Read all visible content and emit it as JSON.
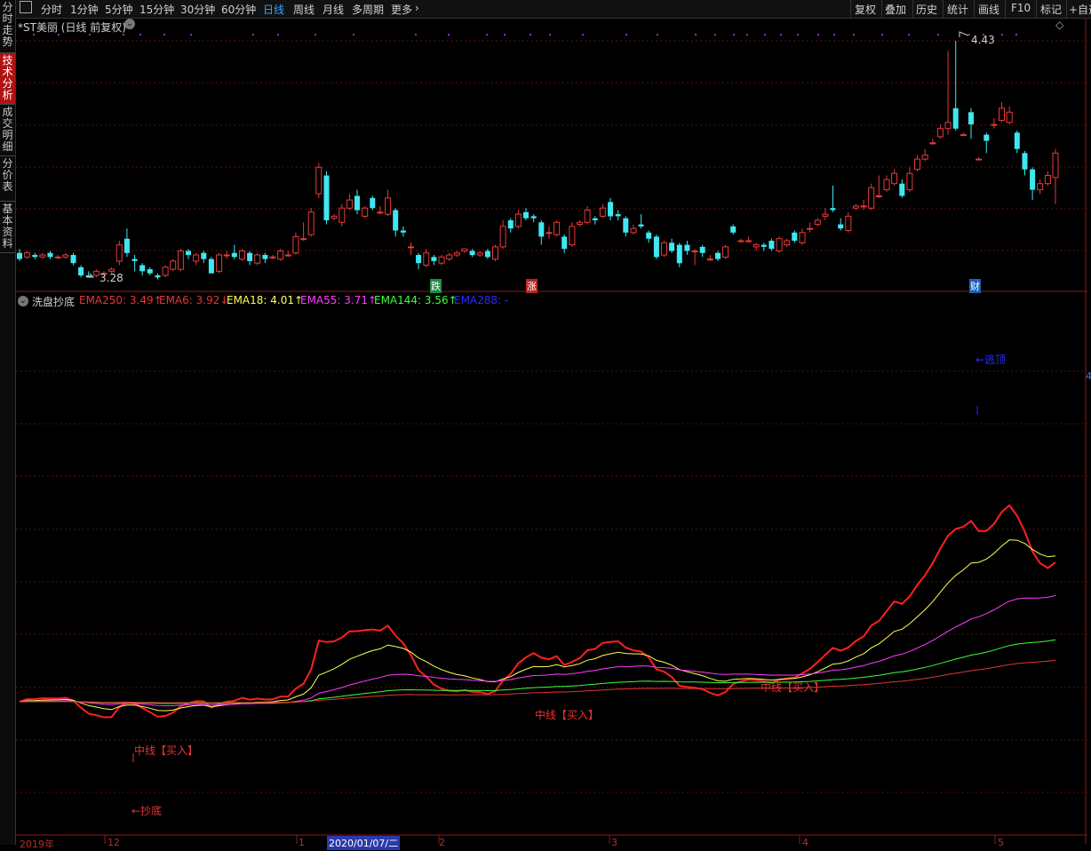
{
  "toolbar": {
    "items": [
      "分时",
      "1分钟",
      "5分钟",
      "15分钟",
      "30分钟",
      "60分钟",
      "日线",
      "周线",
      "月线",
      "多周期",
      "更多"
    ],
    "active": "日线",
    "right_items": [
      "复权",
      "叠加",
      "历史",
      "统计",
      "画线",
      "F10",
      "标记",
      "+自选"
    ]
  },
  "sidebar": {
    "tabs": [
      "分时走势",
      "技术分析",
      "成交明细",
      "分价表",
      "基本资料"
    ],
    "active": "技术分析"
  },
  "main_chart": {
    "title": "*ST美丽 (日线 前复权)",
    "high_label": "4.43",
    "low_label": "3.28",
    "markers": [
      {
        "text": "跌",
        "color": "#2fd06f"
      },
      {
        "text": "涨",
        "color": "#e23a3a"
      },
      {
        "text": "财",
        "color": "#3aa0ff"
      }
    ],
    "candles": [
      {
        "o": 3.39,
        "c": 3.36,
        "h": 3.41,
        "l": 3.35
      },
      {
        "o": 3.37,
        "c": 3.39,
        "h": 3.4,
        "l": 3.36
      },
      {
        "o": 3.38,
        "c": 3.37,
        "h": 3.39,
        "l": 3.36
      },
      {
        "o": 3.37,
        "c": 3.38,
        "h": 3.39,
        "l": 3.36
      },
      {
        "o": 3.39,
        "c": 3.37,
        "h": 3.4,
        "l": 3.36
      },
      {
        "o": 3.37,
        "c": 3.37,
        "h": 3.38,
        "l": 3.36
      },
      {
        "o": 3.37,
        "c": 3.38,
        "h": 3.39,
        "l": 3.36
      },
      {
        "o": 3.38,
        "c": 3.34,
        "h": 3.39,
        "l": 3.33
      },
      {
        "o": 3.32,
        "c": 3.28,
        "h": 3.33,
        "l": 3.27
      },
      {
        "o": 3.28,
        "c": 3.27,
        "h": 3.3,
        "l": 3.27
      },
      {
        "o": 3.28,
        "c": 3.3,
        "h": 3.31,
        "l": 3.27
      },
      {
        "o": 3.29,
        "c": 3.29,
        "h": 3.3,
        "l": 3.28
      },
      {
        "o": 3.3,
        "c": 3.31,
        "h": 3.32,
        "l": 3.29
      },
      {
        "o": 3.35,
        "c": 3.43,
        "h": 3.45,
        "l": 3.33
      },
      {
        "o": 3.46,
        "c": 3.39,
        "h": 3.51,
        "l": 3.37
      },
      {
        "o": 3.36,
        "c": 3.35,
        "h": 3.38,
        "l": 3.3
      },
      {
        "o": 3.33,
        "c": 3.3,
        "h": 3.34,
        "l": 3.28
      },
      {
        "o": 3.31,
        "c": 3.29,
        "h": 3.32,
        "l": 3.28
      },
      {
        "o": 3.28,
        "c": 3.27,
        "h": 3.29,
        "l": 3.26
      },
      {
        "o": 3.28,
        "c": 3.32,
        "h": 3.33,
        "l": 3.27
      },
      {
        "o": 3.31,
        "c": 3.35,
        "h": 3.36,
        "l": 3.3
      },
      {
        "o": 3.31,
        "c": 3.4,
        "h": 3.41,
        "l": 3.3
      },
      {
        "o": 3.4,
        "c": 3.38,
        "h": 3.41,
        "l": 3.36
      },
      {
        "o": 3.35,
        "c": 3.38,
        "h": 3.39,
        "l": 3.33
      },
      {
        "o": 3.39,
        "c": 3.36,
        "h": 3.4,
        "l": 3.34
      },
      {
        "o": 3.36,
        "c": 3.29,
        "h": 3.37,
        "l": 3.29
      },
      {
        "o": 3.3,
        "c": 3.38,
        "h": 3.39,
        "l": 3.29
      },
      {
        "o": 3.38,
        "c": 3.38,
        "h": 3.4,
        "l": 3.36
      },
      {
        "o": 3.39,
        "c": 3.37,
        "h": 3.43,
        "l": 3.36
      },
      {
        "o": 3.36,
        "c": 3.4,
        "h": 3.41,
        "l": 3.35
      },
      {
        "o": 3.39,
        "c": 3.35,
        "h": 3.4,
        "l": 3.33
      },
      {
        "o": 3.34,
        "c": 3.38,
        "h": 3.39,
        "l": 3.33
      },
      {
        "o": 3.38,
        "c": 3.36,
        "h": 3.39,
        "l": 3.34
      },
      {
        "o": 3.37,
        "c": 3.37,
        "h": 3.38,
        "l": 3.36
      },
      {
        "o": 3.36,
        "c": 3.4,
        "h": 3.41,
        "l": 3.35
      },
      {
        "o": 3.38,
        "c": 3.38,
        "h": 3.4,
        "l": 3.37
      },
      {
        "o": 3.39,
        "c": 3.47,
        "h": 3.49,
        "l": 3.38
      },
      {
        "o": 3.46,
        "c": 3.46,
        "h": 3.54,
        "l": 3.45
      },
      {
        "o": 3.48,
        "c": 3.59,
        "h": 3.61,
        "l": 3.47
      },
      {
        "o": 3.68,
        "c": 3.81,
        "h": 3.83,
        "l": 3.66
      },
      {
        "o": 3.77,
        "c": 3.55,
        "h": 3.79,
        "l": 3.53
      },
      {
        "o": 3.56,
        "c": 3.57,
        "h": 3.58,
        "l": 3.55
      },
      {
        "o": 3.54,
        "c": 3.61,
        "h": 3.63,
        "l": 3.52
      },
      {
        "o": 3.61,
        "c": 3.65,
        "h": 3.68,
        "l": 3.6
      },
      {
        "o": 3.67,
        "c": 3.6,
        "h": 3.7,
        "l": 3.58
      },
      {
        "o": 3.57,
        "c": 3.61,
        "h": 3.62,
        "l": 3.56
      },
      {
        "o": 3.66,
        "c": 3.61,
        "h": 3.67,
        "l": 3.6
      },
      {
        "o": 3.59,
        "c": 3.59,
        "h": 3.62,
        "l": 3.58
      },
      {
        "o": 3.58,
        "c": 3.66,
        "h": 3.7,
        "l": 3.57
      },
      {
        "o": 3.6,
        "c": 3.5,
        "h": 3.61,
        "l": 3.47
      },
      {
        "o": 3.5,
        "c": 3.49,
        "h": 3.52,
        "l": 3.47
      },
      {
        "o": 3.42,
        "c": 3.42,
        "h": 3.44,
        "l": 3.38
      },
      {
        "o": 3.38,
        "c": 3.34,
        "h": 3.39,
        "l": 3.31
      },
      {
        "o": 3.33,
        "c": 3.39,
        "h": 3.41,
        "l": 3.32
      },
      {
        "o": 3.37,
        "c": 3.35,
        "h": 3.38,
        "l": 3.33
      },
      {
        "o": 3.34,
        "c": 3.37,
        "h": 3.38,
        "l": 3.33
      },
      {
        "o": 3.36,
        "c": 3.38,
        "h": 3.39,
        "l": 3.35
      },
      {
        "o": 3.38,
        "c": 3.39,
        "h": 3.4,
        "l": 3.37
      },
      {
        "o": 3.4,
        "c": 3.41,
        "h": 3.41,
        "l": 3.39
      },
      {
        "o": 3.4,
        "c": 3.38,
        "h": 3.41,
        "l": 3.37
      },
      {
        "o": 3.38,
        "c": 3.39,
        "h": 3.4,
        "l": 3.37
      },
      {
        "o": 3.4,
        "c": 3.37,
        "h": 3.41,
        "l": 3.36
      },
      {
        "o": 3.36,
        "c": 3.42,
        "h": 3.43,
        "l": 3.35
      },
      {
        "o": 3.42,
        "c": 3.52,
        "h": 3.55,
        "l": 3.41
      },
      {
        "o": 3.55,
        "c": 3.51,
        "h": 3.56,
        "l": 3.49
      },
      {
        "o": 3.52,
        "c": 3.58,
        "h": 3.6,
        "l": 3.51
      },
      {
        "o": 3.59,
        "c": 3.56,
        "h": 3.61,
        "l": 3.55
      },
      {
        "o": 3.57,
        "c": 3.56,
        "h": 3.58,
        "l": 3.54
      },
      {
        "o": 3.54,
        "c": 3.47,
        "h": 3.55,
        "l": 3.43
      },
      {
        "o": 3.49,
        "c": 3.49,
        "h": 3.52,
        "l": 3.46
      },
      {
        "o": 3.48,
        "c": 3.54,
        "h": 3.55,
        "l": 3.47
      },
      {
        "o": 3.47,
        "c": 3.41,
        "h": 3.48,
        "l": 3.39
      },
      {
        "o": 3.43,
        "c": 3.52,
        "h": 3.54,
        "l": 3.42
      },
      {
        "o": 3.53,
        "c": 3.54,
        "h": 3.55,
        "l": 3.52
      },
      {
        "o": 3.54,
        "c": 3.6,
        "h": 3.62,
        "l": 3.53
      },
      {
        "o": 3.56,
        "c": 3.55,
        "h": 3.57,
        "l": 3.53
      },
      {
        "o": 3.57,
        "c": 3.61,
        "h": 3.63,
        "l": 3.56
      },
      {
        "o": 3.64,
        "c": 3.57,
        "h": 3.66,
        "l": 3.55
      },
      {
        "o": 3.58,
        "c": 3.57,
        "h": 3.6,
        "l": 3.55
      },
      {
        "o": 3.56,
        "c": 3.49,
        "h": 3.57,
        "l": 3.47
      },
      {
        "o": 3.49,
        "c": 3.51,
        "h": 3.53,
        "l": 3.48
      },
      {
        "o": 3.53,
        "c": 3.52,
        "h": 3.58,
        "l": 3.51
      },
      {
        "o": 3.49,
        "c": 3.46,
        "h": 3.5,
        "l": 3.44
      },
      {
        "o": 3.47,
        "c": 3.37,
        "h": 3.48,
        "l": 3.36
      },
      {
        "o": 3.38,
        "c": 3.44,
        "h": 3.45,
        "l": 3.37
      },
      {
        "o": 3.44,
        "c": 3.4,
        "h": 3.46,
        "l": 3.39
      },
      {
        "o": 3.43,
        "c": 3.34,
        "h": 3.44,
        "l": 3.32
      },
      {
        "o": 3.43,
        "c": 3.4,
        "h": 3.45,
        "l": 3.38
      },
      {
        "o": 3.4,
        "c": 3.4,
        "h": 3.41,
        "l": 3.33
      },
      {
        "o": 3.42,
        "c": 3.39,
        "h": 3.43,
        "l": 3.37
      },
      {
        "o": 3.36,
        "c": 3.36,
        "h": 3.38,
        "l": 3.35
      },
      {
        "o": 3.39,
        "c": 3.36,
        "h": 3.4,
        "l": 3.35
      },
      {
        "o": 3.37,
        "c": 3.42,
        "h": 3.43,
        "l": 3.36
      },
      {
        "o": 3.52,
        "c": 3.49,
        "h": 3.53,
        "l": 3.48
      },
      {
        "o": 3.45,
        "c": 3.45,
        "h": 3.46,
        "l": 3.44
      },
      {
        "o": 3.45,
        "c": 3.45,
        "h": 3.47,
        "l": 3.44
      },
      {
        "o": 3.42,
        "c": 3.43,
        "h": 3.44,
        "l": 3.4
      },
      {
        "o": 3.43,
        "c": 3.42,
        "h": 3.44,
        "l": 3.4
      },
      {
        "o": 3.45,
        "c": 3.41,
        "h": 3.46,
        "l": 3.4
      },
      {
        "o": 3.4,
        "c": 3.46,
        "h": 3.47,
        "l": 3.39
      },
      {
        "o": 3.43,
        "c": 3.45,
        "h": 3.46,
        "l": 3.42
      },
      {
        "o": 3.49,
        "c": 3.45,
        "h": 3.5,
        "l": 3.44
      },
      {
        "o": 3.44,
        "c": 3.49,
        "h": 3.51,
        "l": 3.43
      },
      {
        "o": 3.51,
        "c": 3.51,
        "h": 3.54,
        "l": 3.49
      },
      {
        "o": 3.53,
        "c": 3.55,
        "h": 3.56,
        "l": 3.52
      },
      {
        "o": 3.57,
        "c": 3.58,
        "h": 3.61,
        "l": 3.55
      },
      {
        "o": 3.61,
        "c": 3.6,
        "h": 3.72,
        "l": 3.59
      },
      {
        "o": 3.53,
        "c": 3.51,
        "h": 3.56,
        "l": 3.5
      },
      {
        "o": 3.5,
        "c": 3.57,
        "h": 3.59,
        "l": 3.49
      },
      {
        "o": 3.61,
        "c": 3.62,
        "h": 3.63,
        "l": 3.6
      },
      {
        "o": 3.62,
        "c": 3.62,
        "h": 3.65,
        "l": 3.6
      },
      {
        "o": 3.61,
        "c": 3.71,
        "h": 3.73,
        "l": 3.6
      },
      {
        "o": 3.67,
        "c": 3.67,
        "h": 3.77,
        "l": 3.66
      },
      {
        "o": 3.7,
        "c": 3.75,
        "h": 3.77,
        "l": 3.69
      },
      {
        "o": 3.73,
        "c": 3.78,
        "h": 3.8,
        "l": 3.72
      },
      {
        "o": 3.73,
        "c": 3.67,
        "h": 3.75,
        "l": 3.66
      },
      {
        "o": 3.7,
        "c": 3.78,
        "h": 3.81,
        "l": 3.69
      },
      {
        "o": 3.8,
        "c": 3.85,
        "h": 3.87,
        "l": 3.79
      },
      {
        "o": 3.85,
        "c": 3.87,
        "h": 3.9,
        "l": 3.84
      },
      {
        "o": 3.93,
        "c": 3.93,
        "h": 3.95,
        "l": 3.92
      },
      {
        "o": 3.96,
        "c": 4.0,
        "h": 4.02,
        "l": 3.95
      },
      {
        "o": 4.0,
        "c": 4.03,
        "h": 4.38,
        "l": 3.97
      },
      {
        "o": 4.1,
        "c": 4.0,
        "h": 4.43,
        "l": 3.99
      },
      {
        "o": 3.97,
        "c": 3.97,
        "h": 3.98,
        "l": 3.97
      },
      {
        "o": 4.08,
        "c": 4.02,
        "h": 4.1,
        "l": 3.95
      },
      {
        "o": 3.85,
        "c": 3.85,
        "h": 3.86,
        "l": 3.85
      },
      {
        "o": 3.97,
        "c": 3.94,
        "h": 3.98,
        "l": 3.88
      },
      {
        "o": 4.02,
        "c": 4.02,
        "h": 4.05,
        "l": 4.0
      },
      {
        "o": 4.04,
        "c": 4.1,
        "h": 4.13,
        "l": 4.03
      },
      {
        "o": 4.03,
        "c": 4.08,
        "h": 4.11,
        "l": 4.02
      },
      {
        "o": 3.98,
        "c": 3.9,
        "h": 3.99,
        "l": 3.88
      },
      {
        "o": 3.88,
        "c": 3.8,
        "h": 3.89,
        "l": 3.77
      },
      {
        "o": 3.8,
        "c": 3.7,
        "h": 3.81,
        "l": 3.65
      },
      {
        "o": 3.7,
        "c": 3.73,
        "h": 3.75,
        "l": 3.68
      },
      {
        "o": 3.73,
        "c": 3.77,
        "h": 3.79,
        "l": 3.72
      },
      {
        "o": 3.76,
        "c": 3.88,
        "h": 3.9,
        "l": 3.63
      }
    ]
  },
  "indicator": {
    "name": "洗盘抄底",
    "values": [
      {
        "text": "EMA250: 3.49↑",
        "color": "#e83333"
      },
      {
        "text": "EMA6: 3.92↓",
        "color": "#e83333"
      },
      {
        "text": "EMA18: 4.01↑",
        "color": "#ffff55"
      },
      {
        "text": "EMA55: 3.71↑",
        "color": "#ff3cff"
      },
      {
        "text": "EMA144: 3.56↑",
        "color": "#3cff3c"
      },
      {
        "text": "EMA288: -",
        "color": "#2a2aff"
      }
    ],
    "annotations": {
      "buy1": "中线【买入】",
      "buy2": "中线【买入】",
      "buy3": "中线【买入】",
      "bottom": "←抄底",
      "top": "←逃顶",
      "right_edge": "4"
    }
  },
  "xaxis": {
    "labels": [
      "2019年",
      "12",
      "1",
      "2020/01/07/二",
      "2",
      "3",
      "4",
      "5"
    ]
  },
  "colors": {
    "up": "#e83a3a",
    "down": "#3ee8f0",
    "grid": "#5a1010",
    "axis": "#8a1a1a"
  }
}
